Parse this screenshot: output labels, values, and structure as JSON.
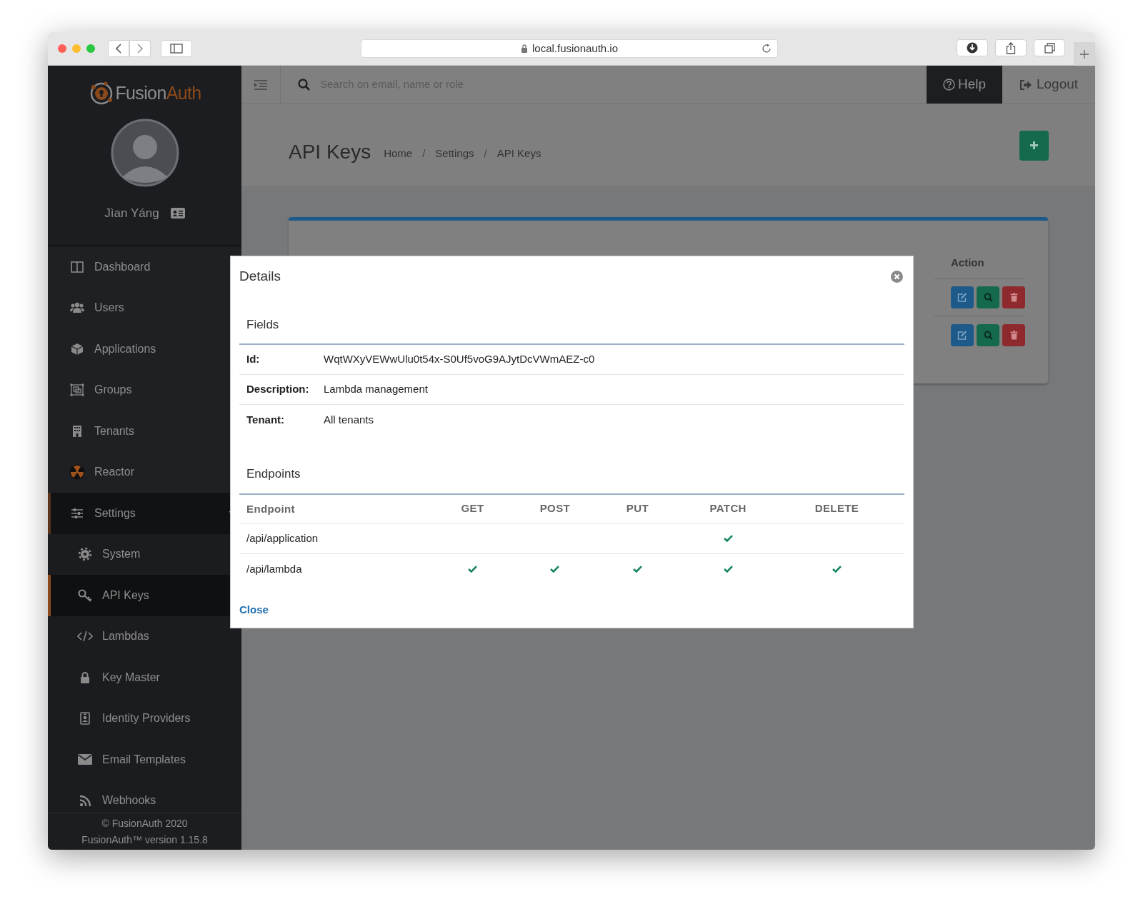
{
  "browser": {
    "url": "local.fusionauth.io"
  },
  "sidebar": {
    "logo": {
      "part_1": "Fusion",
      "part_2": "Auth"
    },
    "user": {
      "name": "Jìan Yáng"
    },
    "items": [
      {
        "label": "Dashboard",
        "selected": false
      },
      {
        "label": "Users",
        "selected": false
      },
      {
        "label": "Applications",
        "selected": false
      },
      {
        "label": "Groups",
        "selected": false
      },
      {
        "label": "Tenants",
        "selected": false
      },
      {
        "label": "Reactor",
        "selected": false
      },
      {
        "label": "Settings",
        "selected": false,
        "expanded": true,
        "children": [
          {
            "label": "System",
            "selected": false
          },
          {
            "label": "API Keys",
            "selected": true
          },
          {
            "label": "Lambdas",
            "selected": false
          },
          {
            "label": "Key Master",
            "selected": false
          },
          {
            "label": "Identity Providers",
            "selected": false
          },
          {
            "label": "Email Templates",
            "selected": false
          },
          {
            "label": "Webhooks",
            "selected": false
          }
        ]
      }
    ],
    "footer": [
      "© FusionAuth 2020",
      "FusionAuth™ version 1.15.8"
    ]
  },
  "header": {
    "search": {
      "placeholder": "Search on email, name or role"
    },
    "help": "Help",
    "logout": "Logout"
  },
  "page": {
    "title": "API Keys",
    "breadcrumbs": [
      "Home",
      "Settings",
      "API Keys"
    ],
    "breadcrumb_separator": "/"
  },
  "card": {
    "columns": [
      "Action"
    ],
    "rows": [
      {
        "actions": [
          {
            "kind": "edit"
          },
          {
            "kind": "view"
          },
          {
            "kind": "delete"
          }
        ]
      },
      {
        "actions": [
          {
            "kind": "edit"
          },
          {
            "kind": "view"
          },
          {
            "kind": "delete"
          }
        ]
      }
    ]
  },
  "modal": {
    "title": "Details",
    "fields_heading": "Fields",
    "fields": [
      {
        "label": "Id:",
        "value": "WqtWXyVEWwUlu0t54x-S0Uf5voG9AJytDcVWmAEZ-c0"
      },
      {
        "label": "Description:",
        "value": "Lambda management"
      },
      {
        "label": "Tenant:",
        "value": "All tenants"
      }
    ],
    "endpoints_heading": "Endpoints",
    "columns": [
      "Endpoint",
      "GET",
      "POST",
      "PUT",
      "PATCH",
      "DELETE"
    ],
    "rows": [
      {
        "endpoint": "/api/application",
        "methods": [
          {
            "checked": false
          },
          {
            "checked": false
          },
          {
            "checked": false
          },
          {
            "checked": true
          },
          {
            "checked": false
          }
        ]
      },
      {
        "endpoint": "/api/lambda",
        "methods": [
          {
            "checked": true
          },
          {
            "checked": true
          },
          {
            "checked": true
          },
          {
            "checked": true
          },
          {
            "checked": true
          }
        ]
      }
    ],
    "close": "Close"
  }
}
